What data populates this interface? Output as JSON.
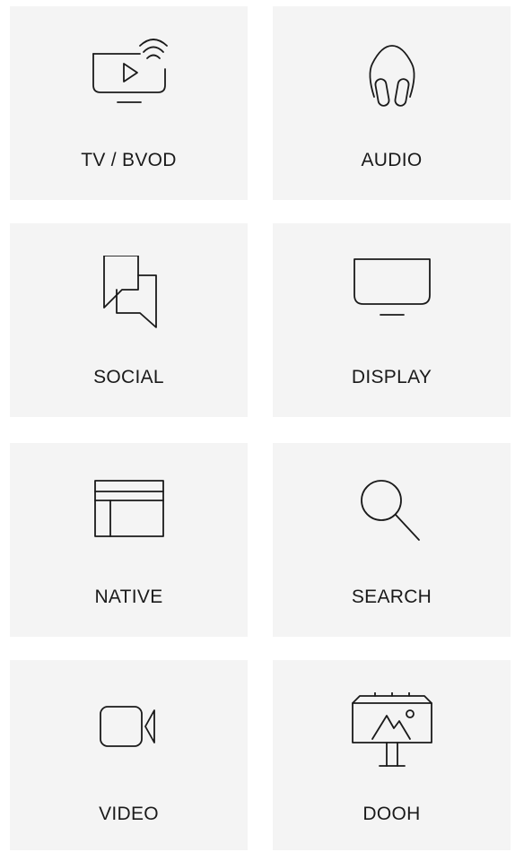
{
  "tiles": [
    {
      "label": "TV / BVOD",
      "icon": "connected-tv-icon"
    },
    {
      "label": "AUDIO",
      "icon": "headphones-icon"
    },
    {
      "label": "SOCIAL",
      "icon": "chat-bubbles-icon"
    },
    {
      "label": "DISPLAY",
      "icon": "monitor-icon"
    },
    {
      "label": "NATIVE",
      "icon": "layout-grid-icon"
    },
    {
      "label": "SEARCH",
      "icon": "magnifier-icon"
    },
    {
      "label": "VIDEO",
      "icon": "video-camera-icon"
    },
    {
      "label": "DOOH",
      "icon": "billboard-icon"
    }
  ],
  "colors": {
    "tile_background": "#f4f4f4",
    "icon_stroke": "#1a1a1a",
    "text": "#1a1a1a"
  }
}
